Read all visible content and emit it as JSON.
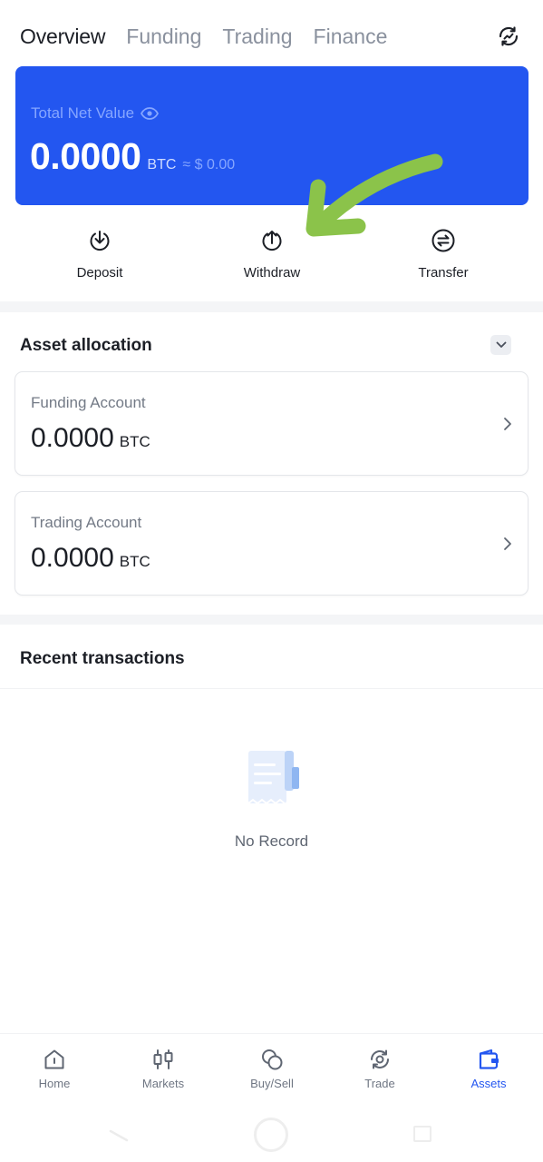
{
  "tabs": [
    "Overview",
    "Funding",
    "Trading",
    "Finance"
  ],
  "net_card": {
    "label": "Total Net Value",
    "value": "0.0000",
    "unit": "BTC",
    "fiat": "≈ $ 0.00"
  },
  "actions": {
    "deposit": "Deposit",
    "withdraw": "Withdraw",
    "transfer": "Transfer"
  },
  "asset_allocation": {
    "title": "Asset allocation",
    "accounts": [
      {
        "name": "Funding Account",
        "value": "0.0000",
        "unit": "BTC"
      },
      {
        "name": "Trading Account",
        "value": "0.0000",
        "unit": "BTC"
      }
    ]
  },
  "recent": {
    "title": "Recent transactions",
    "empty_text": "No Record"
  },
  "bottom_nav": {
    "home": "Home",
    "markets": "Markets",
    "buysell": "Buy/Sell",
    "trade": "Trade",
    "assets": "Assets"
  },
  "colors": {
    "brand": "#2356f0",
    "annotation_arrow": "#8bc34a"
  }
}
